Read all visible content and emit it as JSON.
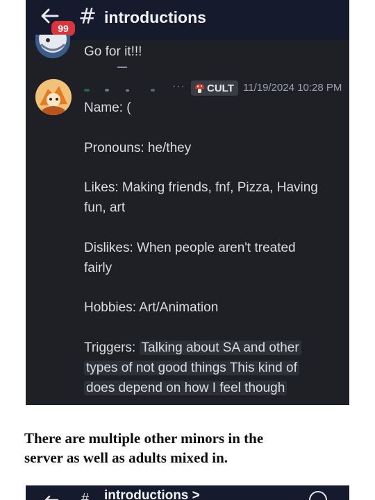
{
  "header": {
    "unread_count": "99",
    "hash_symbol": "#",
    "channel_name": "introductions"
  },
  "messages": {
    "previous_text": "Go for it!!!",
    "author_tag": "CULT",
    "timestamp": "11/19/2024 10:28 PM",
    "lines": [
      "Name: (",
      "Pronouns: he/they",
      "Likes: Making friends, fnf, Pizza, Having",
      "fun, art",
      "Dislikes: When people aren't treated",
      "fairly",
      "Hobbies: Art/Animation",
      "Triggers:",
      "Talking about SA and other",
      "types of not good things This kind of",
      "does depend on how I feel though"
    ]
  },
  "caption": {
    "line1": "There are multiple other minors in the",
    "line2": "server as well as adults mixed in."
  },
  "second_screenshot": {
    "hash_symbol": "#",
    "title": "introductions >"
  },
  "icons": {
    "back": "arrow-left-icon",
    "tag": "mushroom-icon"
  },
  "colors": {
    "background": "#1f2025",
    "topbar": "#151a2c",
    "badge": "#d9353d",
    "text": "#dcdde2"
  }
}
